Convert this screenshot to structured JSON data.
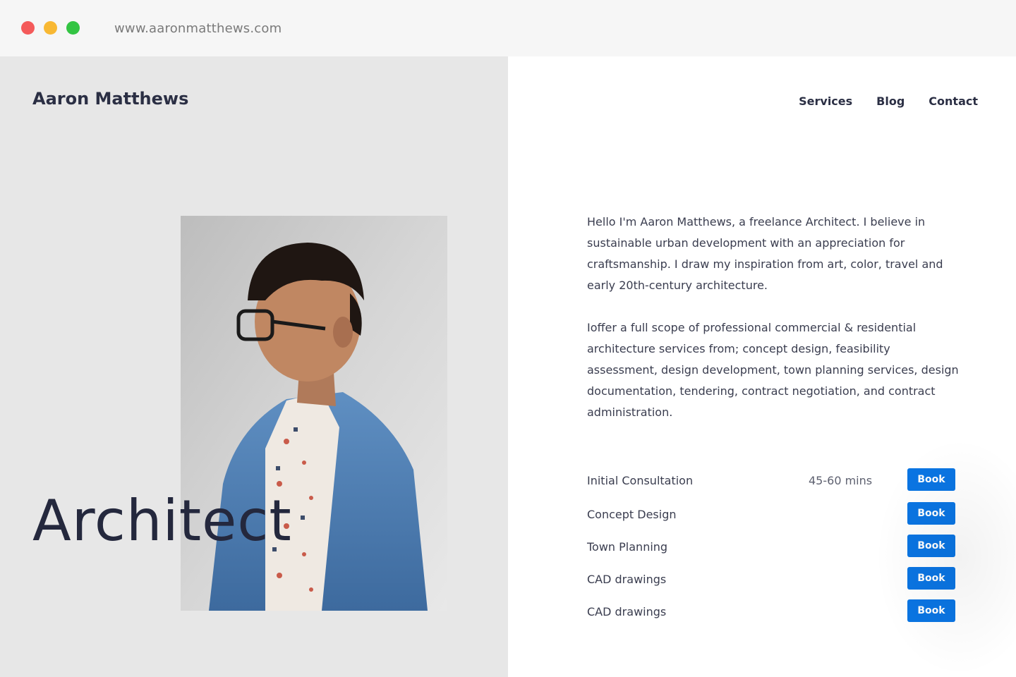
{
  "browser": {
    "url": "www.aaronmatthews.com"
  },
  "brand": {
    "name": "Aaron Matthews"
  },
  "hero": {
    "headline": "Architect"
  },
  "nav": {
    "items": [
      {
        "label": "Services"
      },
      {
        "label": "Blog"
      },
      {
        "label": "Contact"
      }
    ]
  },
  "bio": {
    "paragraph_1": "Hello I'm Aaron Matthews, a freelance Architect. I believe in sustainable urban development with an appreciation for craftsmanship. I draw my inspiration from art, color, travel and early 20th-century architecture.",
    "paragraph_2": "Ioffer a full scope of professional commercial & residential architecture services from; concept design, feasibility assessment, design development, town planning services, design documentation, tendering, contract negotiation, and contract administration."
  },
  "services": [
    {
      "name": "Initial Consultation",
      "duration": "45-60 mins",
      "button": "Book"
    },
    {
      "name": "Concept Design",
      "duration": "",
      "button": "Book"
    },
    {
      "name": "Town Planning",
      "duration": "",
      "button": "Book"
    },
    {
      "name": "CAD drawings",
      "duration": "",
      "button": "Book"
    },
    {
      "name": "CAD drawings",
      "duration": "",
      "button": "Book"
    }
  ],
  "colors": {
    "accent": "#0a75e3",
    "left_panel": "#e7e7e7",
    "text_dark": "#2b2f44"
  }
}
